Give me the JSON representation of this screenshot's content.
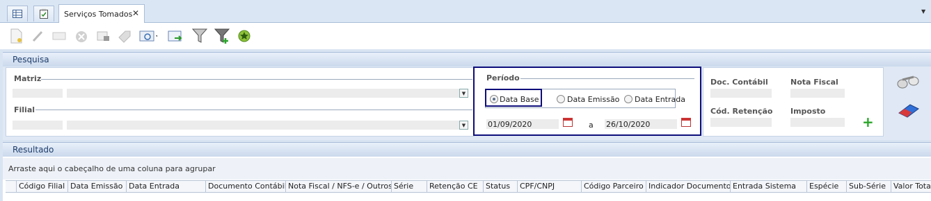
{
  "tabs": {
    "icon_tab_1": "grid-table-icon",
    "icon_tab_2": "clipboard-check-icon",
    "active_label": "Serviços Tomados"
  },
  "toolbar": {
    "icons": [
      "new-document-icon",
      "edit-icon",
      "minus-icon",
      "delete-icon",
      "lock-icon",
      "tag-icon",
      "view-options-icon",
      "export-icon",
      "filter-icon",
      "add-filter-icon",
      "favorite-icon"
    ]
  },
  "pesquisa": {
    "title": "Pesquisa",
    "matriz_label": "Matriz",
    "filial_label": "Filial",
    "periodo_label": "Período",
    "radio_data_base": "Data Base",
    "radio_data_emissao": "Data Emissão",
    "radio_data_entrada": "Data Entrada",
    "date_from": "01/09/2020",
    "date_sep": "a",
    "date_to": "26/10/2020",
    "doc_contabil_label": "Doc. Contábil",
    "nota_fiscal_label": "Nota Fiscal",
    "cod_retencao_label": "Cód. Retenção",
    "imposto_label": "Imposto"
  },
  "resultado": {
    "title": "Resultado",
    "group_hint": "Arraste aqui o cabeçalho de uma coluna para agrupar",
    "columns": [
      "Código Filial",
      "Data Emissão",
      "Data Entrada",
      "Documento Contábil",
      "Nota Fiscal / NFS-e / Outros",
      "Série",
      "Retenção CE",
      "Status",
      "CPF/CNPJ",
      "Código Parceiro",
      "Indicador Documento",
      "Entrada Sistema",
      "Espécie",
      "Sub-Série",
      "Valor Total"
    ]
  },
  "colors": {
    "highlight_border": "#0d0d7a",
    "header_text": "#1e3d6b"
  }
}
